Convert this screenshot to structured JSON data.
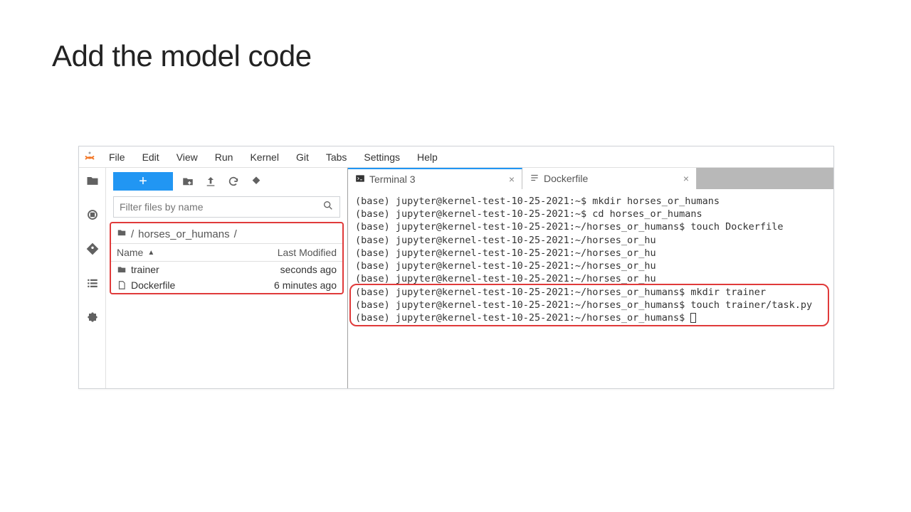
{
  "page": {
    "heading": "Add the model code"
  },
  "menu": [
    "File",
    "Edit",
    "View",
    "Run",
    "Kernel",
    "Git",
    "Tabs",
    "Settings",
    "Help"
  ],
  "filter": {
    "placeholder": "Filter files by name"
  },
  "breadcrumb": {
    "root": "/",
    "folder": "horses_or_humans",
    "trail": "/"
  },
  "columns": {
    "name": "Name",
    "modified": "Last Modified"
  },
  "files": [
    {
      "type": "folder",
      "name": "trainer",
      "modified": "seconds ago"
    },
    {
      "type": "file",
      "name": "Dockerfile",
      "modified": "6 minutes ago"
    }
  ],
  "tabs": [
    {
      "id": "terminal",
      "label": "Terminal 3",
      "icon": "terminal",
      "active": true
    },
    {
      "id": "dockerfile",
      "label": "Dockerfile",
      "icon": "lines",
      "active": false
    }
  ],
  "terminal": {
    "prompt_short": "(base) jupyter@kernel-test-10-25-2021:~/horses_or_hu",
    "prompt_full": "(base) jupyter@kernel-test-10-25-2021:~/horses_or_humans$",
    "prompt_home": "(base) jupyter@kernel-test-10-25-2021:~$",
    "lines": [
      "(base) jupyter@kernel-test-10-25-2021:~$ mkdir horses_or_humans",
      "(base) jupyter@kernel-test-10-25-2021:~$ cd horses_or_humans",
      "(base) jupyter@kernel-test-10-25-2021:~/horses_or_humans$ touch Dockerfile",
      "(base) jupyter@kernel-test-10-25-2021:~/horses_or_hu",
      "(base) jupyter@kernel-test-10-25-2021:~/horses_or_hu",
      "(base) jupyter@kernel-test-10-25-2021:~/horses_or_hu",
      "(base) jupyter@kernel-test-10-25-2021:~/horses_or_hu",
      "(base) jupyter@kernel-test-10-25-2021:~/horses_or_humans$ mkdir trainer",
      "(base) jupyter@kernel-test-10-25-2021:~/horses_or_humans$ touch trainer/task.py",
      "(base) jupyter@kernel-test-10-25-2021:~/horses_or_humans$ "
    ],
    "highlight_start": 7,
    "highlight_end": 9
  }
}
